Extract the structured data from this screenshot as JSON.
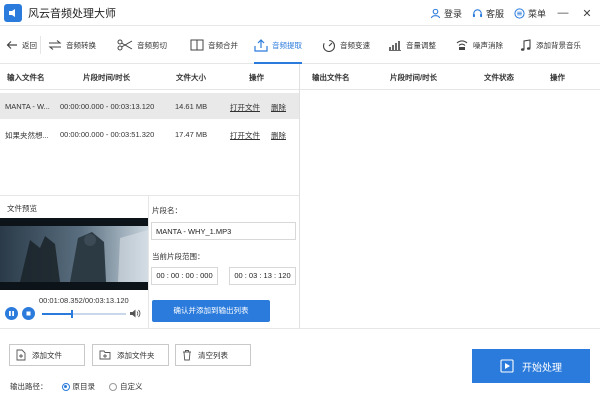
{
  "app": {
    "title": "风云音频处理大师",
    "accent": "#2b7bdc"
  },
  "titlebar": {
    "login_label": "登录",
    "service_label": "客服",
    "menu_label": "菜单",
    "minimize_glyph": "—",
    "close_glyph": "✕"
  },
  "toolbar": {
    "back_label": "返回",
    "items": [
      {
        "label": "音频转换",
        "icon": "convert-icon",
        "active": false
      },
      {
        "label": "音频剪切",
        "icon": "scissors-icon",
        "active": false
      },
      {
        "label": "音频合并",
        "icon": "merge-icon",
        "active": false
      },
      {
        "label": "音频提取",
        "icon": "extract-icon",
        "active": true
      },
      {
        "label": "音频变速",
        "icon": "speed-icon",
        "active": false
      },
      {
        "label": "音量调整",
        "icon": "volume-bars-icon",
        "active": false
      },
      {
        "label": "噪声消除",
        "icon": "noise-icon",
        "active": false
      },
      {
        "label": "添加背景音乐",
        "icon": "music-note-icon",
        "active": false
      }
    ]
  },
  "input_table": {
    "columns": [
      "输入文件名",
      "片段时间/时长",
      "文件大小",
      "操作"
    ],
    "rows": [
      {
        "name": "MANTA - W...",
        "time": "00:00:00.000 - 00:03:13.120",
        "size": "14.61 MB",
        "open": "打开文件",
        "delete": "删除",
        "selected": true
      },
      {
        "name": "如果夹然想...",
        "time": "00:00:00.000 - 00:03:51.320",
        "size": "17.47 MB",
        "open": "打开文件",
        "delete": "删除",
        "selected": false
      }
    ]
  },
  "output_table": {
    "columns": [
      "输出文件名",
      "片段时间/时长",
      "文件状态",
      "操作"
    ]
  },
  "preview": {
    "label": "文件预览",
    "time_readout": "00:01:08.352/00:03:13.120",
    "progress_fraction": 0.353
  },
  "segment": {
    "name_label": "片段名：",
    "name_value": "MANTA - WHY_1.MP3",
    "range_label": "当前片段范围：",
    "start_time": "00 : 00 : 00 : 000",
    "end_time": "00 : 03 : 13 : 120",
    "confirm_label": "确认并添加到输出列表"
  },
  "bottom": {
    "add_file_label": "添加文件",
    "add_folder_label": "添加文件夹",
    "clear_list_label": "清空列表",
    "start_label": "开始处理",
    "output_path_label": "输出路径：",
    "option_original": "原目录",
    "option_custom": "自定义",
    "selected_option": "original"
  }
}
